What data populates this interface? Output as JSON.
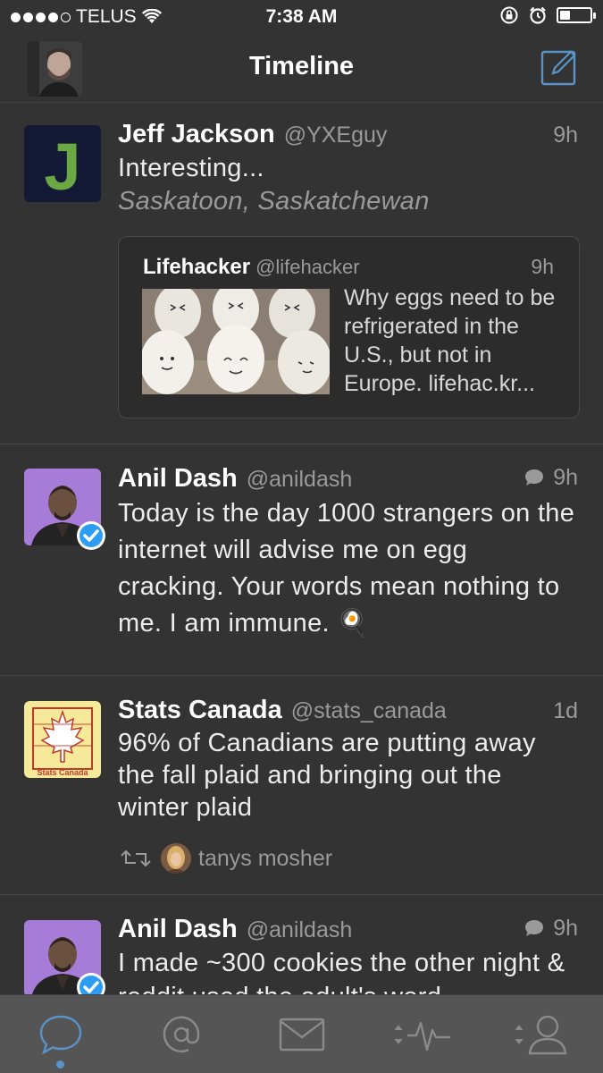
{
  "status_bar": {
    "carrier": "TELUS",
    "time": "7:38 AM",
    "battery_level": 0.35
  },
  "nav": {
    "title": "Timeline"
  },
  "tweets": [
    {
      "name": "Jeff Jackson",
      "handle": "@YXEguy",
      "time": "9h",
      "text": "Interesting...",
      "place": "Saskatoon, Saskatchewan",
      "avatar_letter": "J",
      "quote": {
        "name": "Lifehacker",
        "handle": "@lifehacker",
        "time": "9h",
        "text": "Why eggs need to be refrigerated in the U.S., but not in Europe. lifehac.kr..."
      }
    },
    {
      "name": "Anil Dash",
      "handle": "@anildash",
      "time": "9h",
      "text": "Today is the day 1000 strangers on the internet will advise me on egg cracking. Your words mean nothing to me. I am immune. 🍳"
    },
    {
      "name": "Stats Canada",
      "handle": "@stats_canada",
      "time": "1d",
      "text": "96% of Canadians are putting away the fall plaid and bringing out the winter plaid",
      "retweeted_by": "tanys mosher",
      "avatar_label": "Stats Canada"
    },
    {
      "name": "Anil Dash",
      "handle": "@anildash",
      "time": "9h",
      "text": "I made ~300 cookies the other night & reddit used the adult's word"
    }
  ],
  "tabs": [
    {
      "icon": "home-bubble-icon",
      "active": true
    },
    {
      "icon": "mentions-icon",
      "active": false
    },
    {
      "icon": "messages-icon",
      "active": false
    },
    {
      "icon": "activity-icon",
      "active": false
    },
    {
      "icon": "profile-icon",
      "active": false
    }
  ],
  "colors": {
    "background": "#333333",
    "accent": "#5a93c7",
    "tab_bar": "#555555"
  }
}
